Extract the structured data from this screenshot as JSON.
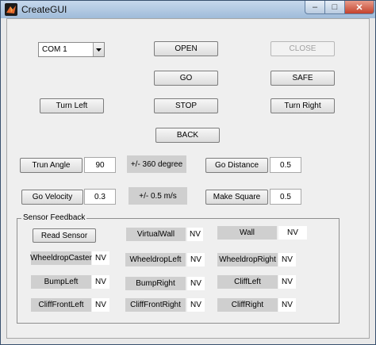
{
  "window": {
    "title": "CreateGUI",
    "minimize": "–",
    "maximize": "□",
    "close": "✕"
  },
  "controls": {
    "com_port": "COM 1",
    "open": "OPEN",
    "close": "CLOSE",
    "go": "GO",
    "safe": "SAFE",
    "turn_left": "Turn Left",
    "stop": "STOP",
    "turn_right": "Turn Right",
    "back": "BACK",
    "turn_angle": {
      "label": "Trun Angle",
      "value": "90",
      "range": "+/- 360 degree"
    },
    "go_distance": {
      "label": "Go Distance",
      "value": "0.5"
    },
    "go_velocity": {
      "label": "Go Velocity",
      "value": "0.3",
      "range": "+/- 0.5 m/s"
    },
    "make_square": {
      "label": "Make Square",
      "value": "0.5"
    }
  },
  "sensor_feedback": {
    "title": "Sensor Feedback",
    "read_sensor": "Read Sensor",
    "sensors": [
      {
        "label": "VirtualWall",
        "value": "NV"
      },
      {
        "label": "Wall",
        "value": "NV"
      },
      {
        "label": "WheeldropCaster",
        "value": "NV"
      },
      {
        "label": "WheeldropLeft",
        "value": "NV"
      },
      {
        "label": "WheeldropRight",
        "value": "NV"
      },
      {
        "label": "BumpLeft",
        "value": "NV"
      },
      {
        "label": "BumpRight",
        "value": "NV"
      },
      {
        "label": "CliffLeft",
        "value": "NV"
      },
      {
        "label": "CliffFrontLeft",
        "value": "NV"
      },
      {
        "label": "CliffFrontRight",
        "value": "NV"
      },
      {
        "label": "CliffRight",
        "value": "NV"
      }
    ]
  }
}
